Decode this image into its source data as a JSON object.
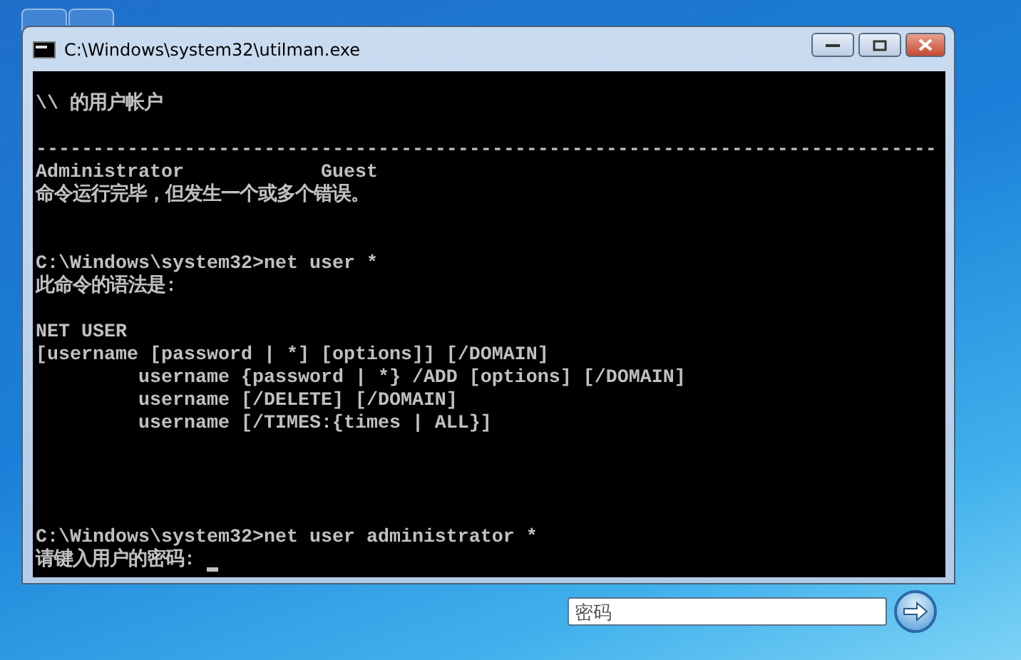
{
  "window": {
    "title": "C:\\Windows\\system32\\utilman.exe"
  },
  "console": {
    "lines": [
      {
        "kind": "blank"
      },
      {
        "kind": "text",
        "text": "\\\\ 的用户帐户"
      },
      {
        "kind": "blank"
      },
      {
        "kind": "text",
        "text": "-------------------------------------------------------------------------------"
      },
      {
        "kind": "text",
        "text": "Administrator            Guest"
      },
      {
        "kind": "text",
        "text": "命令运行完毕，但发生一个或多个错误。"
      },
      {
        "kind": "blank"
      },
      {
        "kind": "blank"
      },
      {
        "kind": "text",
        "text": "C:\\Windows\\system32>net user *"
      },
      {
        "kind": "text",
        "text": "此命令的语法是:"
      },
      {
        "kind": "blank"
      },
      {
        "kind": "text",
        "text": "NET USER"
      },
      {
        "kind": "text",
        "text": "[username [password | *] [options]] [/DOMAIN]"
      },
      {
        "kind": "text",
        "text": "         username {password | *} /ADD [options] [/DOMAIN]"
      },
      {
        "kind": "text",
        "text": "         username [/DELETE] [/DOMAIN]"
      },
      {
        "kind": "text",
        "text": "         username [/TIMES:{times | ALL}]"
      },
      {
        "kind": "blank"
      },
      {
        "kind": "blank"
      },
      {
        "kind": "blank"
      },
      {
        "kind": "blank"
      },
      {
        "kind": "text",
        "text": "C:\\Windows\\system32>net user administrator *"
      },
      {
        "kind": "text",
        "text": "请键入用户的密码: ",
        "cursor": true
      }
    ]
  },
  "password_field": {
    "placeholder": "密码"
  }
}
